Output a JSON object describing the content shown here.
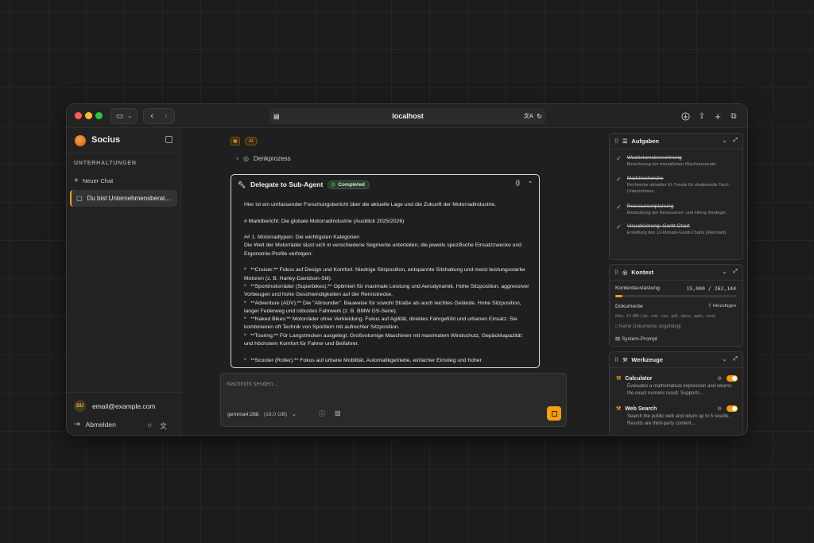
{
  "browser": {
    "url": "localhost",
    "colors": {
      "close": "#ff5f57",
      "minimize": "#febc2e",
      "maximize": "#28c840"
    }
  },
  "sidebar": {
    "brand": "Socius",
    "section_label": "UNTERHALTUNGEN",
    "new_chat_label": "Neuer Chat",
    "chats": [
      {
        "label": "Du bist Unternehmensberat..."
      }
    ],
    "user": {
      "initials": "DU",
      "email": "email@example.com"
    },
    "logout_label": "Abmelden"
  },
  "main": {
    "ai_badge": "AI",
    "thinking_label": "Denkprozess",
    "agent": {
      "title": "Delegate to Sub-Agent",
      "status": "Completed",
      "code_toggle": "{}",
      "paragraphs": [
        "Hier ist ein umfassender Forschungsbericht über die aktuelle Lage und die Zukunft der Motorradindustrie.",
        "# Marktbericht: Die globale Motorradindustrie (Ausblick 2025/2026)",
        "## 1. Motorradtypen: Die wichtigsten Kategorien\nDie Welt der Motorräder lässt sich in verschiedene Segmente unterteilen, die jeweils spezifische Einsatzzwecke und Ergonomie-Profile verfolgen:",
        "*   **Cruiser:** Fokus auf Design und Komfort. Niedrige Sitzposition, entspannte Sitzhaltung und meist leistungsstarke Motoren (z. B. Harley-Davidson-Stil).\n*   **Sportmotorräder (Superbikes):** Optimiert für maximale Leistung und Aerodynamik. Hohe Sitzposition, aggressiver Vorbeugen und hohe Geschwindigkeiten auf der Rennstrecke.\n*   **Adventure (ADV):** Die \"Allrounder\". Bauweise für sowohl Straße als auch leichtes Gelände. Hohe Sitzposition, langer Federweg und robustes Fahrwerk (z. B. BMW GS-Serie).\n*   **Naked Bikes:** Motorräder ohne Verkleidung. Fokus auf Agilität, direktes Fahrgefühl und urbanen Einsatz. Sie kombinieren oft Technik von Sportlern mit aufrechter Sitzposition.\n*   **Touring:** Für Langstrecken ausgelegt. Großvolumige Maschinen mit maximalem Windschutz, Gepäckkapazität und höchstem Komfort für Fahrer und Beifahrer.",
        "*   **Scooter (Roller):** Fokus auf urbane Mobilität, Automatikgetriebe, einfacher Einstieg und hoher"
      ]
    },
    "composer": {
      "placeholder": "Nachricht senden...",
      "model": "gemma4:26b",
      "model_size": "(18.0 GB)"
    }
  },
  "panels": {
    "tasks": {
      "title": "Aufgaben",
      "items": [
        {
          "title": "Wachstumsberechnung",
          "desc": "Berechnung der monatlichen Wachstumsrate."
        },
        {
          "title": "Marktrecherche",
          "desc": "Recherche aktueller KI-Trends für skalierende Tech-Unternehmen."
        },
        {
          "title": "Ressourcenplanung",
          "desc": "Entwicklung der Ressourcen- und Hiring-Strategie."
        },
        {
          "title": "Visualisierung: Gantt-Chart",
          "desc": "Erstellung des 12-Monats-Gantt-Charts (Mermaid)."
        }
      ]
    },
    "context": {
      "title": "Kontext",
      "usage_label": "Kontextauslastung",
      "usage_value": "15,000 / 262,144",
      "usage_fraction": 0.057,
      "docs_label": "Dokumente",
      "add_label": "Hinzufügen",
      "docs_hint": "Max. 10 MB (.txt, .md, .csv, .pdf, .docx, .pptx, .xlsx)",
      "no_docs": "Keine Dokumente angehängt",
      "system_prompt": "System-Prompt"
    },
    "tools": {
      "title": "Werkzeuge",
      "items": [
        {
          "name": "Calculator",
          "desc": "Evaluates a mathematical expression and returns the exact numeric result. Supports..."
        },
        {
          "name": "Web Search",
          "desc": "Search the public web and return up to 5 results. Results are third-party content..."
        }
      ]
    }
  }
}
